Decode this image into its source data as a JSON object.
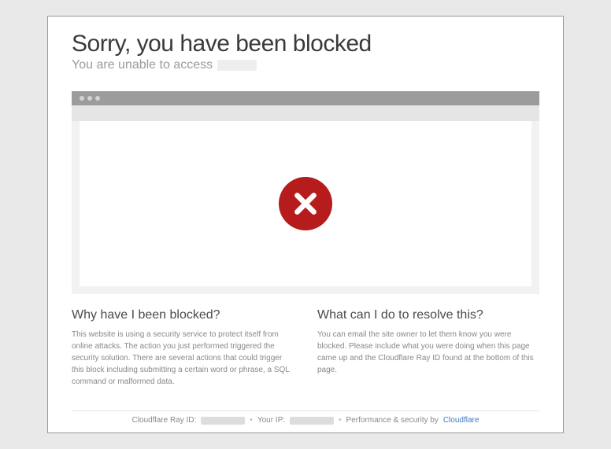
{
  "header": {
    "title": "Sorry, you have been blocked",
    "subtitle_prefix": "You are unable to access"
  },
  "error_icon": {
    "name": "x-circle-icon",
    "color": "#b71c1c"
  },
  "columns": {
    "left": {
      "heading": "Why have I been blocked?",
      "text": "This website is using a security service to protect itself from online attacks. The action you just performed triggered the security solution. There are several actions that could trigger this block including submitting a certain word or phrase, a SQL command or malformed data."
    },
    "right": {
      "heading": "What can I do to resolve this?",
      "text": "You can email the site owner to let them know you were blocked. Please include what you were doing when this page came up and the Cloudflare Ray ID found at the bottom of this page."
    }
  },
  "footer": {
    "ray_label": "Cloudflare Ray ID:",
    "ip_label": "Your IP:",
    "perf_label": "Performance & security by",
    "provider": "Cloudflare",
    "separator": "•"
  }
}
